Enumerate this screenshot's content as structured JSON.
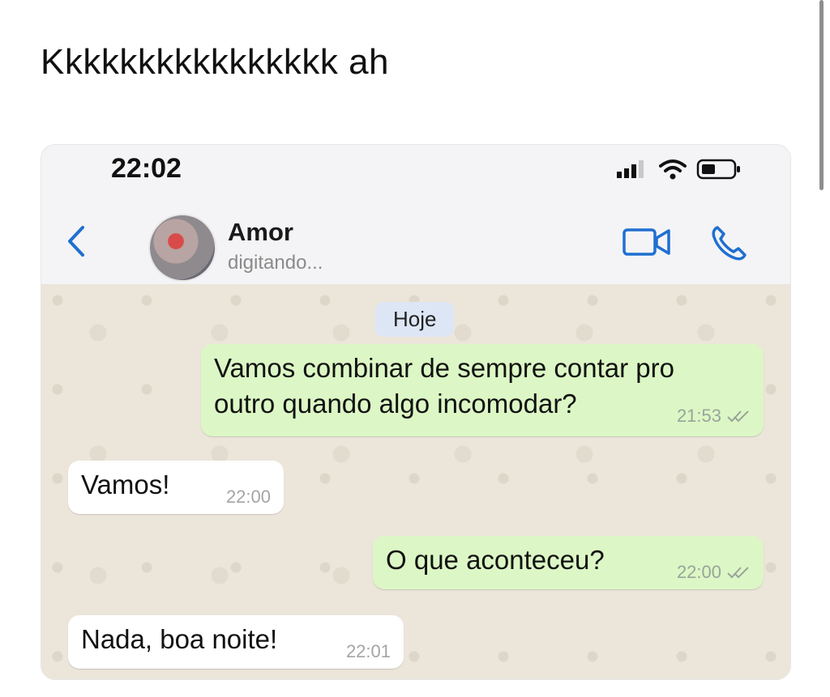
{
  "caption": "Kkkkkkkkkkkkkkkk ah",
  "status_bar": {
    "time": "22:02",
    "icons": [
      "signal-icon",
      "wifi-icon",
      "battery-icon"
    ]
  },
  "header": {
    "back_icon": "chevron-left-icon",
    "contact_name": "Amor",
    "contact_status": "digitando...",
    "actions": [
      "video-call-icon",
      "phone-icon"
    ]
  },
  "chat": {
    "date_chip": "Hoje",
    "messages": [
      {
        "direction": "outgoing",
        "lines": [
          "Vamos combinar de sempre contar pro",
          "outro quando algo incomodar?"
        ],
        "time": "21:53",
        "status": "read"
      },
      {
        "direction": "incoming",
        "text": "Vamos!",
        "time": "22:00"
      },
      {
        "direction": "outgoing",
        "text": "O que aconteceu?",
        "time": "22:00",
        "status": "read"
      },
      {
        "direction": "incoming",
        "text": "Nada, boa noite!",
        "time": "22:01"
      }
    ]
  },
  "colors": {
    "accent": "#1f6fd1",
    "outgoing_bubble": "#dcf7c5",
    "incoming_bubble": "#ffffff",
    "chat_background": "#ece5da",
    "date_chip": "#dde6f5"
  }
}
